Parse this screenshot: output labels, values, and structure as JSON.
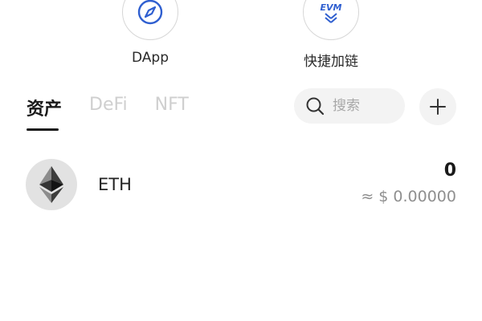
{
  "shortcuts": [
    {
      "label": "DApp",
      "icon": "compass-icon"
    },
    {
      "label": "快捷加链",
      "icon": "evm-icon",
      "icon_text": "EVM"
    }
  ],
  "tabs": [
    {
      "label": "资产",
      "active": true
    },
    {
      "label": "DeFi",
      "active": false
    },
    {
      "label": "NFT",
      "active": false
    }
  ],
  "search": {
    "placeholder": "搜索",
    "icon": "search-icon"
  },
  "add_button": {
    "icon": "plus-icon"
  },
  "assets": [
    {
      "name": "ETH",
      "amount": "0",
      "fiat": "≈ $ 0.00000",
      "icon": "eth-icon"
    }
  ],
  "colors": {
    "accent_blue": "#4a6fd8",
    "tab_inactive": "#cfcfcf",
    "text_primary": "#1a1a1a",
    "text_secondary": "#8f8f8f"
  }
}
